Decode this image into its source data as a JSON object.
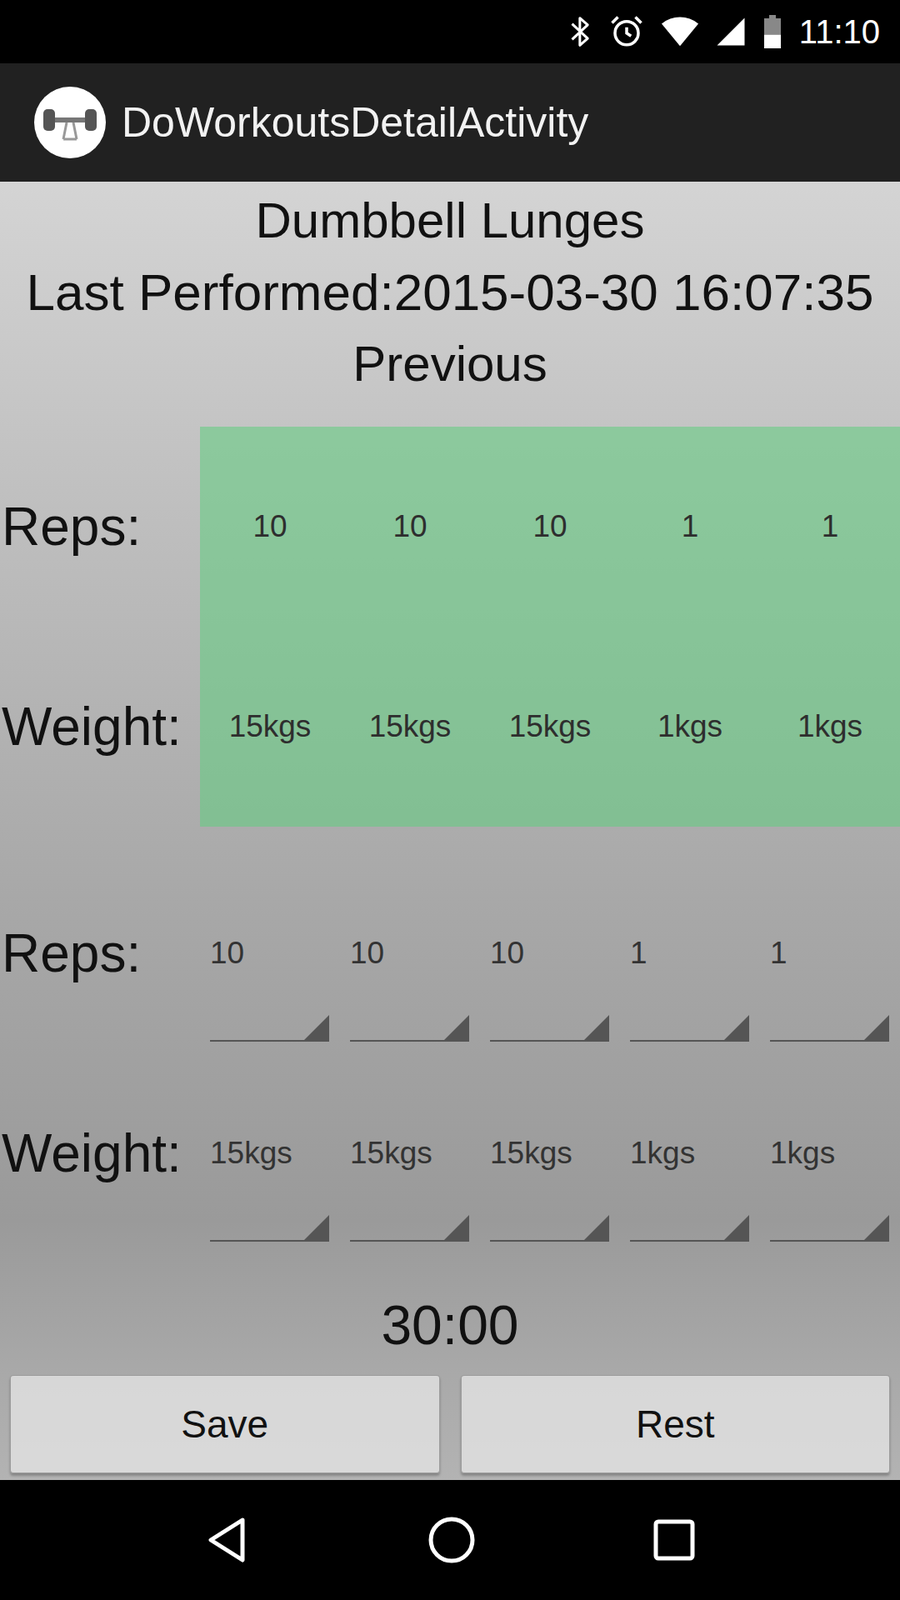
{
  "status_bar": {
    "time": "11:10",
    "battery": {
      "level": 0.45
    }
  },
  "app_bar": {
    "title": "DoWorkoutsDetailActivity"
  },
  "exercise": {
    "name": "Dumbbell Lunges",
    "last_performed": "Last Performed:2015-03-30 16:07:35"
  },
  "previous": {
    "heading": "Previous",
    "reps_label": "Reps:",
    "weight_label": "Weight:",
    "sets": [
      {
        "reps": "10",
        "weight": "15kgs"
      },
      {
        "reps": "10",
        "weight": "15kgs"
      },
      {
        "reps": "10",
        "weight": "15kgs"
      },
      {
        "reps": "1",
        "weight": "1kgs"
      },
      {
        "reps": "1",
        "weight": "1kgs"
      }
    ]
  },
  "current": {
    "reps_label": "Reps:",
    "weight_label": "Weight:",
    "sets": [
      {
        "reps": "10",
        "weight": "15kgs"
      },
      {
        "reps": "10",
        "weight": "15kgs"
      },
      {
        "reps": "10",
        "weight": "15kgs"
      },
      {
        "reps": "1",
        "weight": "1kgs"
      },
      {
        "reps": "1",
        "weight": "1kgs"
      }
    ]
  },
  "timer": "30:00",
  "buttons": [
    "Save",
    "Rest"
  ]
}
